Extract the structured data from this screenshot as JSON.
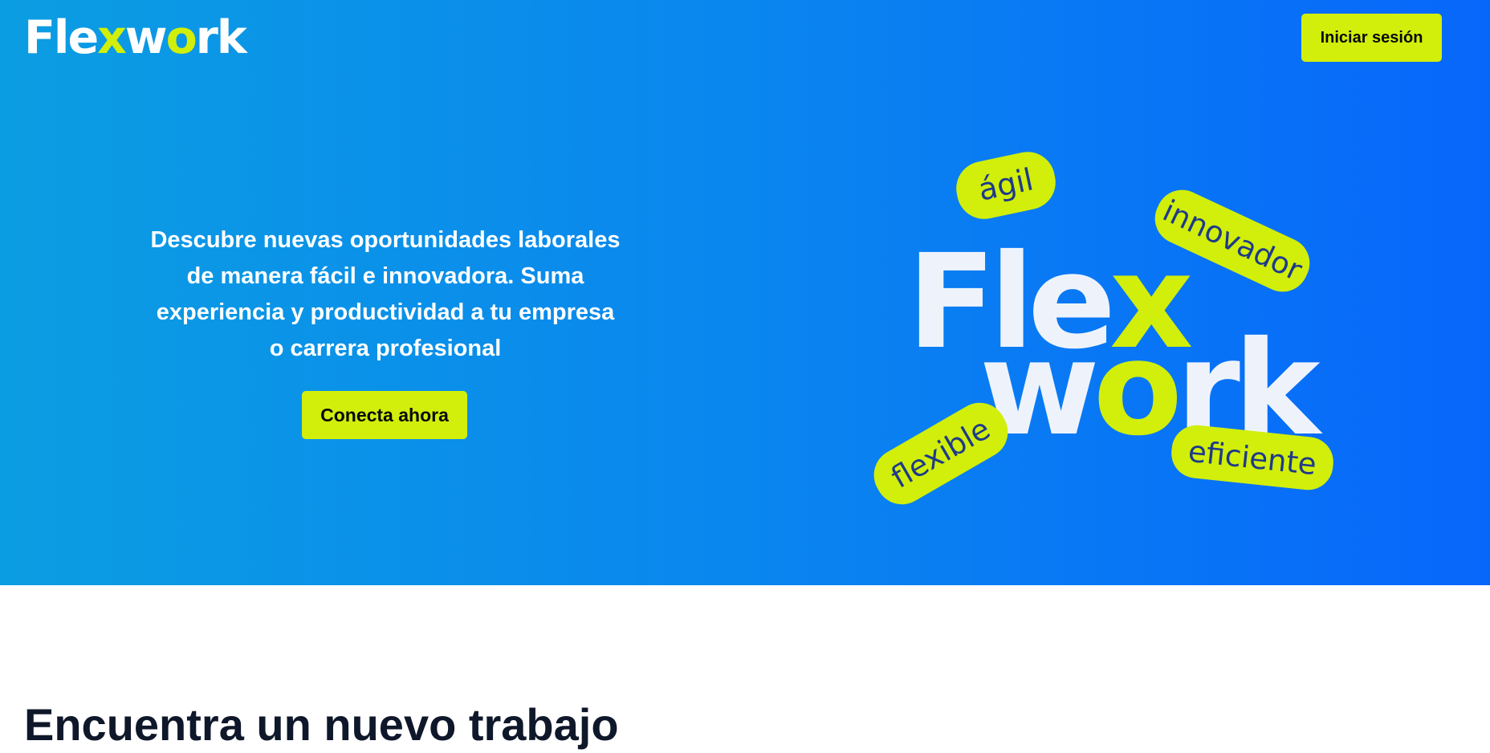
{
  "brand": {
    "logo_part1": "Fle",
    "logo_x": "x",
    "logo_part2": "w",
    "logo_o": "o",
    "logo_part3": "rk",
    "accent_color": "#d1ef0a",
    "gradient_start": "#0b9de2",
    "gradient_end": "#0767fb"
  },
  "header": {
    "login_label": "Iniciar sesión"
  },
  "hero": {
    "headline_lines": [
      "Descubre nuevas oportunidades laborales",
      "de manera fácil e innovadora. Suma",
      "experiencia y productividad a tu empresa",
      "o carrera profesional"
    ],
    "cta_label": "Conecta ahora"
  },
  "illustration": {
    "word1_a": "Fle",
    "word1_b": "x",
    "word2_a": "w",
    "word2_b": "o",
    "word2_c": "rk",
    "tags": [
      "ágil",
      "innovador",
      "flexible",
      "eficiente"
    ]
  },
  "section": {
    "heading_partial": "Encuentra un nuevo trabajo"
  }
}
